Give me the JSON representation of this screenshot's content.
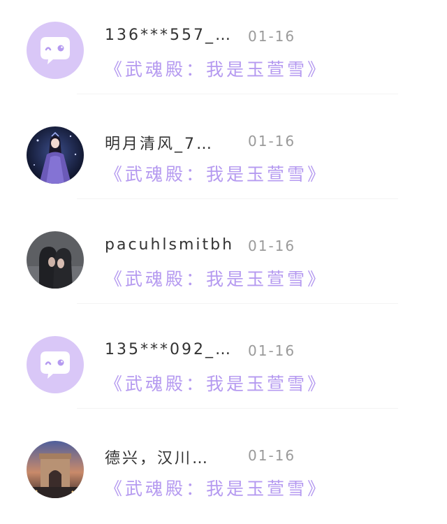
{
  "messages": [
    {
      "name": "136***557_…",
      "date": "01-16",
      "title": "《武魂殿：我是玉萱雪》",
      "avatar": "default-chat-avatar"
    },
    {
      "name": "明月清风_7…",
      "date": "01-16",
      "title": "《武魂殿：我是玉萱雪》",
      "avatar": "anime-girl-photo"
    },
    {
      "name": "pacuhlsmitbh",
      "date": "01-16",
      "title": "《武魂殿：我是玉萱雪》",
      "avatar": "two-people-photo"
    },
    {
      "name": "135***092_…",
      "date": "01-16",
      "title": "《武魂殿：我是玉萱雪》",
      "avatar": "default-chat-avatar"
    },
    {
      "name": "德兴，汉川…",
      "date": "01-16",
      "title": "《武魂殿：我是玉萱雪》",
      "avatar": "arc-de-triomphe-photo"
    }
  ],
  "colors": {
    "title": "#b59af0",
    "avatar_default_bg": "#d9c7f7",
    "name": "#333333",
    "date": "#9a9a9a"
  }
}
